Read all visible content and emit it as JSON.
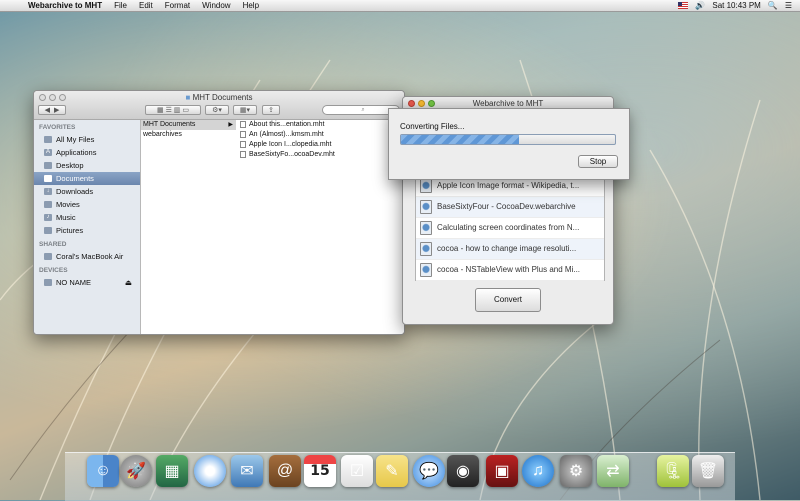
{
  "menubar": {
    "apple": "",
    "app": "Webarchive to MHT",
    "items": [
      "File",
      "Edit",
      "Format",
      "Window",
      "Help"
    ],
    "clock": "Sat 10:43 PM"
  },
  "finder": {
    "title": "MHT Documents",
    "search_placeholder": "",
    "sidebar": {
      "favorites_header": "FAVORITES",
      "favorites": [
        "All My Files",
        "Applications",
        "Desktop",
        "Documents",
        "Downloads",
        "Movies",
        "Music",
        "Pictures"
      ],
      "shared_header": "SHARED",
      "shared": [
        "Coral's MacBook Air"
      ],
      "devices_header": "DEVICES",
      "devices": [
        "NO NAME"
      ]
    },
    "column1": [
      "MHT Documents",
      "webarchives"
    ],
    "column2": [
      "About this...entation.mht",
      "An (Almost)...kmsm.mht",
      "Apple Icon I...clopedia.mht",
      "BaseSixtyFo...ocoaDev.mht"
    ]
  },
  "converter": {
    "title": "Webarchive to MHT",
    "files": [
      "Apple Icon Image format - Wikipedia, t...",
      "BaseSixtyFour - CocoaDev.webarchive",
      "Calculating screen coordinates from N...",
      "cocoa - how to change image resoluti...",
      "cocoa - NSTableView with Plus and Mi..."
    ],
    "convert_label": "Convert"
  },
  "progress": {
    "label": "Converting Files...",
    "fraction": 0.55,
    "stop_label": "Stop"
  },
  "dock": {
    "icons": [
      "finder-icon",
      "launchpad-icon",
      "mission-control-icon",
      "safari-icon",
      "mail-icon",
      "contacts-icon",
      "calendar-icon",
      "reminders-icon",
      "notes-icon",
      "messages-icon",
      "facetime-icon",
      "photo-booth-icon",
      "itunes-icon",
      "system-preferences-icon",
      "webarchive-app-icon",
      "archive-utility-icon",
      "trash-icon"
    ],
    "calendar_day": "15"
  }
}
